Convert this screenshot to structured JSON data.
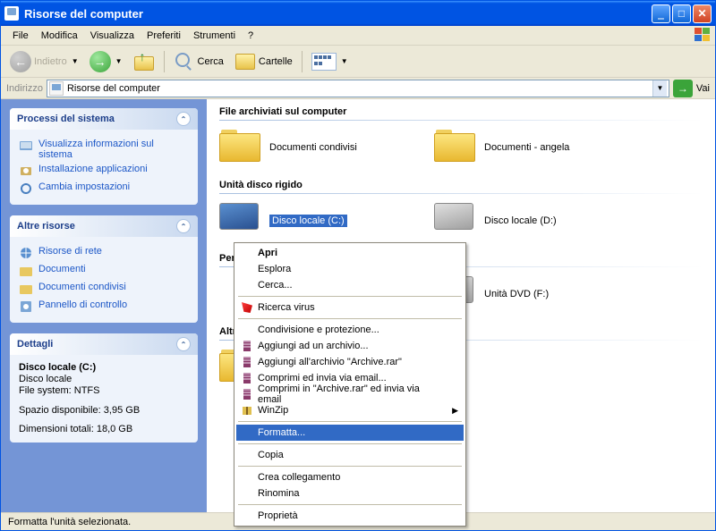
{
  "window": {
    "title": "Risorse del computer"
  },
  "menubar": {
    "items": [
      "File",
      "Modifica",
      "Visualizza",
      "Preferiti",
      "Strumenti",
      "?"
    ]
  },
  "toolbar": {
    "back": "Indietro",
    "search": "Cerca",
    "folders": "Cartelle"
  },
  "address": {
    "label": "Indirizzo",
    "value": "Risorse del computer",
    "go": "Vai"
  },
  "sidebar": {
    "panels": [
      {
        "title": "Processi del sistema",
        "links": [
          "Visualizza informazioni sul sistema",
          "Installazione applicazioni",
          "Cambia impostazioni"
        ]
      },
      {
        "title": "Altre risorse",
        "links": [
          "Risorse di rete",
          "Documenti",
          "Documenti condivisi",
          "Pannello di controllo"
        ]
      },
      {
        "title": "Dettagli",
        "details": {
          "name": "Disco locale (C:)",
          "type": "Disco locale",
          "fs_label": "File system:",
          "fs_value": "NTFS",
          "free_label": "Spazio disponibile:",
          "free_value": "3,95 GB",
          "total_label": "Dimensioni totali:",
          "total_value": "18,0 GB"
        }
      }
    ]
  },
  "main": {
    "sections": [
      {
        "title": "File archiviati sul computer",
        "items": [
          "Documenti condivisi",
          "Documenti - angela"
        ]
      },
      {
        "title": "Unità disco rigido",
        "items": [
          "Disco locale (C:)",
          "Disco locale (D:)"
        ]
      },
      {
        "title_prefix": "Perif",
        "items": [
          "Unità DVD (F:)"
        ]
      },
      {
        "title_prefix": "Altro",
        "items": []
      }
    ]
  },
  "contextmenu": {
    "items": [
      {
        "label": "Apri",
        "bold": true
      },
      {
        "label": "Esplora"
      },
      {
        "label": "Cerca..."
      },
      {
        "sep": true
      },
      {
        "label": "Ricerca virus",
        "icon": "av"
      },
      {
        "sep": true
      },
      {
        "label": "Condivisione e protezione..."
      },
      {
        "label": "Aggiungi ad un archivio...",
        "icon": "rar"
      },
      {
        "label": "Aggiungi all'archivio \"Archive.rar\"",
        "icon": "rar"
      },
      {
        "label": "Comprimi ed invia via email...",
        "icon": "rar"
      },
      {
        "label": "Comprimi in \"Archive.rar\" ed invia via email",
        "icon": "rar"
      },
      {
        "label": "WinZip",
        "icon": "zip",
        "submenu": true
      },
      {
        "sep": true
      },
      {
        "label": "Formatta...",
        "highlighted": true
      },
      {
        "sep": true
      },
      {
        "label": "Copia"
      },
      {
        "sep": true
      },
      {
        "label": "Crea collegamento"
      },
      {
        "label": "Rinomina"
      },
      {
        "sep": true
      },
      {
        "label": "Proprietà"
      }
    ]
  },
  "statusbar": {
    "text": "Formatta l'unità selezionata."
  }
}
